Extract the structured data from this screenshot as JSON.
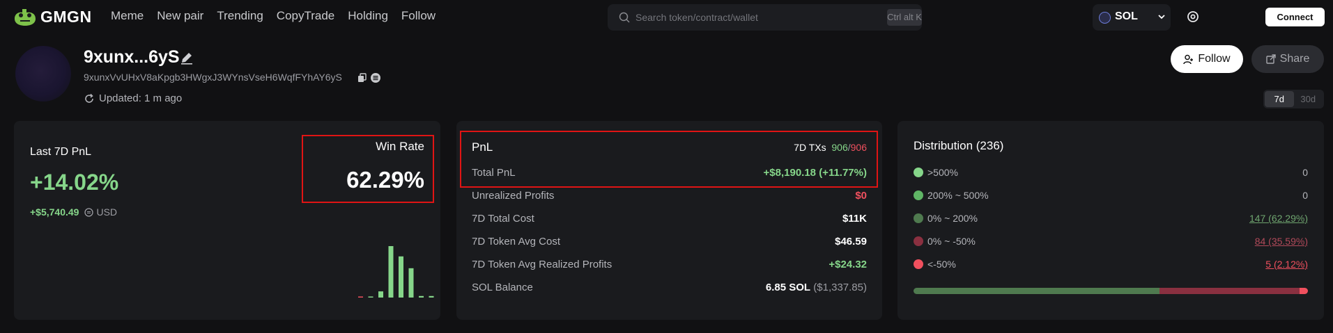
{
  "header": {
    "logo_text": "GMGN",
    "nav": [
      "Meme",
      "New pair",
      "Trending",
      "CopyTrade",
      "Holding",
      "Follow"
    ],
    "search_placeholder": "Search token/contract/wallet",
    "search_shortcut": "Ctrl alt K",
    "chain": "SOL",
    "connect_label": "Connect"
  },
  "profile": {
    "name": "9xunx...6yS",
    "address": "9xunxVvUHxV8aKpgb3HWgxJ3WYnsVseH6WqfFYhAY6yS",
    "updated": "Updated: 1 m ago",
    "follow_label": "Follow",
    "share_label": "Share",
    "ranges": [
      "7d",
      "30d"
    ],
    "active_range": "7d"
  },
  "last_pnl": {
    "title": "Last 7D PnL",
    "percent": "+14.02%",
    "usd_amount": "+$5,740.49",
    "currency": "USD",
    "win_rate_label": "Win Rate",
    "win_rate": "62.29%"
  },
  "mini_chart": {
    "bars": [
      {
        "value": 0.02,
        "color": "#f0505e"
      },
      {
        "value": 0.0,
        "color": "#86d68a"
      },
      {
        "value": 0.12,
        "color": "#86d68a"
      },
      {
        "value": 1.0,
        "color": "#86d68a"
      },
      {
        "value": 0.8,
        "color": "#86d68a"
      },
      {
        "value": 0.57,
        "color": "#86d68a"
      },
      {
        "value": 0.03,
        "color": "#86d68a"
      },
      {
        "value": 0.03,
        "color": "#86d68a"
      }
    ]
  },
  "pnl": {
    "title": "PnL",
    "txs_label": "7D TXs",
    "txs_buy": "906",
    "txs_sep": "/",
    "txs_sell": "906",
    "total_label": "Total PnL",
    "total_value": "+$8,190.18 (+11.77%)",
    "rows": [
      {
        "label": "Unrealized Profits",
        "value": "$0"
      },
      {
        "label": "7D Total Cost",
        "value": "$11K"
      },
      {
        "label": "7D Token Avg Cost",
        "value": "$46.59"
      },
      {
        "label": "7D Token Avg Realized Profits",
        "value": "+$24.32"
      },
      {
        "label": "SOL Balance",
        "value": "6.85 SOL",
        "value_sub": "($1,337.85)"
      }
    ]
  },
  "distribution": {
    "title": "Distribution (236)",
    "rows": [
      {
        "label": ">500%",
        "value": "0",
        "color": "#86d68a"
      },
      {
        "label": "200% ~ 500%",
        "value": "0",
        "color": "#5fb565"
      },
      {
        "label": "0% ~ 200%",
        "value": "147 (62.29%)",
        "color": "#4f7a4f"
      },
      {
        "label": "0% ~ -50%",
        "value": "84 (35.59%)",
        "color": "#8a3040"
      },
      {
        "label": "<-50%",
        "value": "5 (2.12%)",
        "color": "#f0505e"
      }
    ],
    "bar": [
      {
        "share": 0.6229,
        "color": "#4f7a4f"
      },
      {
        "share": 0.3559,
        "color": "#8a3040"
      },
      {
        "share": 0.0212,
        "color": "#f0505e"
      }
    ]
  }
}
